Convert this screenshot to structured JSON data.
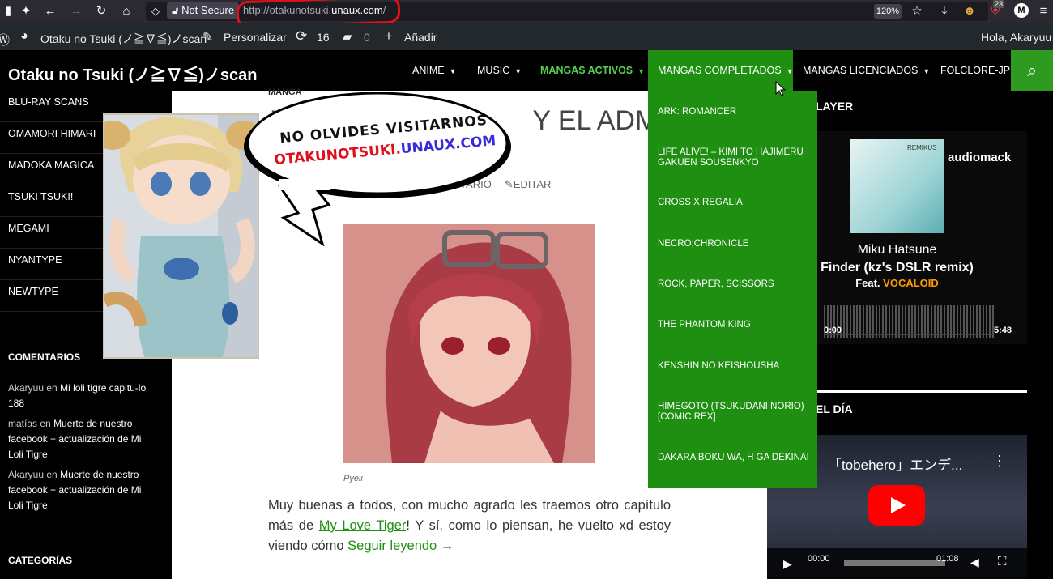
{
  "browser": {
    "not_secure": "Not Secure",
    "url_prefix": "http://otakunotsuki.",
    "url_main": "unaux.com",
    "url_suffix": "/",
    "zoom": "120%",
    "badge_count": "23",
    "profile_letter": "M"
  },
  "admin_bar": {
    "site_name": "Otaku no Tsuki (ノ≧∇≦)ノscan",
    "customize": "Personalizar",
    "updates": "16",
    "comments": "0",
    "add_new": "Añadir",
    "greeting": "Hola, Akaryuu"
  },
  "header": {
    "site_title": "Otaku no Tsuki (ノ≧∇≦)ノscan",
    "nav": [
      {
        "label": "ANIME"
      },
      {
        "label": "MUSIC"
      },
      {
        "label": "MANGAS ACTIVOS"
      },
      {
        "label": "MANGAS COMPLETADOS"
      },
      {
        "label": "MANGAS LICENCIADOS"
      },
      {
        "label": "FOLCLORE-JP"
      }
    ]
  },
  "dropdown": {
    "items": [
      "ARK: ROMANCER",
      "LIFE ALIVE! – KIMI TO HAJIMERU GAKUEN SOUSENKYO",
      "CROSS X REGALIA",
      "NECRO;CHRONICLE",
      "ROCK, PAPER, SCISSORS",
      "THE PHANTOM KING",
      "KENSHIN NO KEISHOUSHA",
      "HIMEGOTO (TSUKUDANI NORIO) [COMIC REX]",
      "DAKARA BOKU WA, H GA DEKINAI"
    ]
  },
  "left_sidebar": {
    "items": [
      "BLU-RAY SCANS",
      "OMAMORI HIMARI",
      "MADOKA MAGICA",
      "TSUKI TSUKI!",
      "MEGAMI",
      "NYANTYPE",
      "NEWTYPE"
    ],
    "comments_heading": "COMENTARIOS",
    "comments": [
      {
        "author": "Akaryuu",
        "en": "en",
        "post": "Mi loli tigre capitu-lo 188"
      },
      {
        "author": "matías",
        "en": "en",
        "post": "Muerte de nuestro facebook + actualización de Mi Loli Tigre"
      },
      {
        "author": "Akaryuu",
        "en": "en",
        "post": "Muerte de nuestro facebook + actualización de Mi Loli Tigre"
      }
    ],
    "categories_heading": "CATEGORÍAS"
  },
  "bubble": {
    "line1": "NO OLVIDES VISITARNOS",
    "line2a": "OTAKUNOTSUKI.",
    "line2b": "UNAUX.COM"
  },
  "post": {
    "category": "MANGA",
    "title_visible": "M",
    "title_right": "Y EL ADMIN",
    "meta_comment": "ENTARIO",
    "meta_edit": "EDITAR",
    "caption": "Pyeii",
    "para_1": "Muy buenas a todos, con mucho agrado les traemos otro capítulo más de ",
    "link_title": "My Love Tiger",
    "para_2": "! Y sí, como lo piensan, he vuelto xd  estoy viendo cómo ",
    "read_more": "Seguir leyendo →"
  },
  "right_sidebar": {
    "player_heading": "LAYER",
    "player": {
      "album_label": "REMIKUS",
      "brand": "audiomack",
      "artist": "Miku Hatsune",
      "track": "Finder (kz's DSLR remix)",
      "feat_label": "Feat.",
      "feat_name": "VOCALOID",
      "time_start": "0:00",
      "time_end": "5:48"
    },
    "video_heading": "EL DÍA",
    "video": {
      "title": "「tobehero」エンデ...",
      "time_current": "00:00",
      "time_total": "01:08"
    }
  },
  "colors": {
    "accent_green": "#1f8f12",
    "active_nav": "#55d14d",
    "url_circle": "#e0101a",
    "vocaloid_orange": "#ff9b00",
    "youtube_red": "#ff0000"
  }
}
